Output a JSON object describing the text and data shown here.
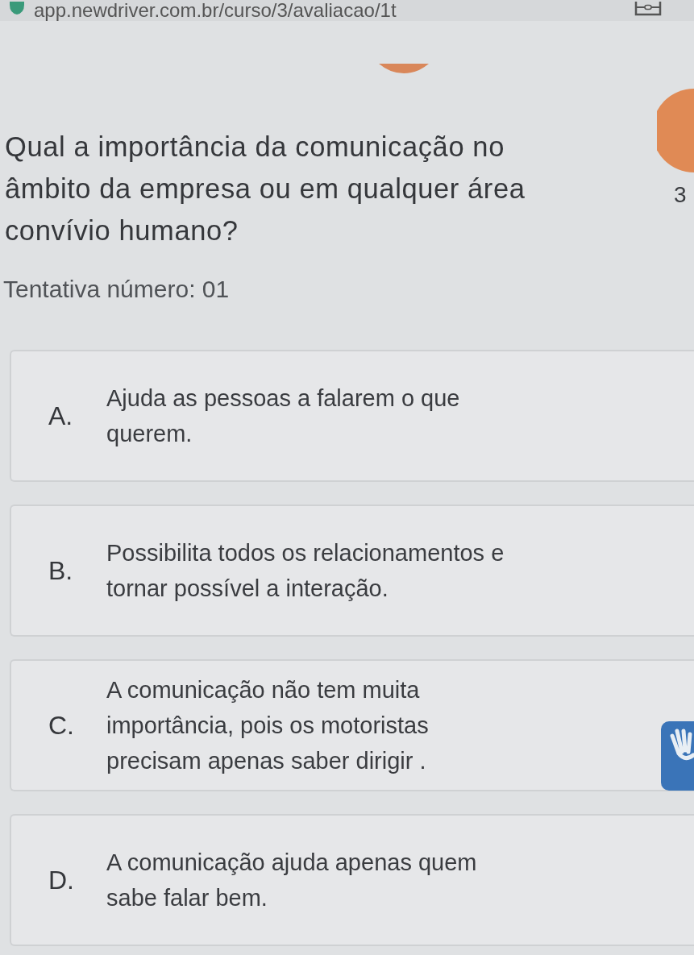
{
  "address_bar": {
    "url": "app.newdriver.com.br/curso/3/avaliacao/1t"
  },
  "question": {
    "lines": [
      "Qual a importância da comunicação no",
      "âmbito da empresa ou em qualquer área",
      "convívio humano?"
    ]
  },
  "side_counter": "3",
  "attempt": "Tentativa número: 01",
  "options": [
    {
      "letter": "A.",
      "lines": [
        "Ajuda as pessoas a falarem o que",
        "querem."
      ]
    },
    {
      "letter": "B.",
      "lines": [
        "Possibilita todos os relacionamentos e",
        "tornar possível a interação."
      ]
    },
    {
      "letter": "C.",
      "lines": [
        "A comunicação não tem muita",
        "importância, pois os motoristas",
        "precisam apenas saber dirigir ."
      ]
    },
    {
      "letter": "D.",
      "lines": [
        "A comunicação ajuda apenas quem",
        "sabe falar bem."
      ]
    }
  ]
}
